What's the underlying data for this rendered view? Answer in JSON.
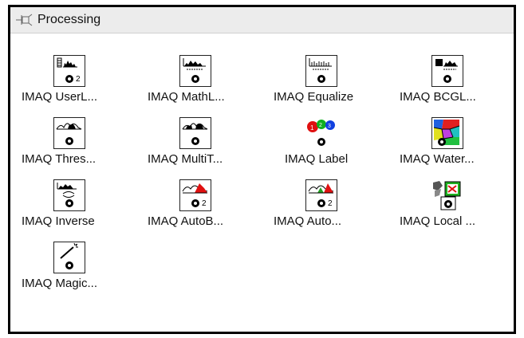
{
  "palette": {
    "title": "Processing"
  },
  "items": [
    {
      "label": "IMAQ UserL...",
      "icon": "user-lookup-icon",
      "badge": "2"
    },
    {
      "label": "IMAQ MathL...",
      "icon": "math-lookup-icon"
    },
    {
      "label": "IMAQ Equalize",
      "icon": "equalize-icon"
    },
    {
      "label": "IMAQ BCGL...",
      "icon": "bcg-lookup-icon"
    },
    {
      "label": "IMAQ Thres...",
      "icon": "threshold-icon"
    },
    {
      "label": "IMAQ MultiT...",
      "icon": "multi-threshold-icon"
    },
    {
      "label": "IMAQ Label",
      "icon": "label-icon"
    },
    {
      "label": "IMAQ Water...",
      "icon": "watershed-icon"
    },
    {
      "label": "IMAQ Inverse",
      "icon": "inverse-icon"
    },
    {
      "label": "IMAQ AutoB...",
      "icon": "auto-binary-icon",
      "badge": "2"
    },
    {
      "label": "IMAQ Auto...",
      "icon": "auto-threshold-icon",
      "badge": "2"
    },
    {
      "label": "IMAQ Local ...",
      "icon": "local-threshold-icon"
    },
    {
      "label": "IMAQ Magic...",
      "icon": "magic-wand-icon"
    }
  ]
}
